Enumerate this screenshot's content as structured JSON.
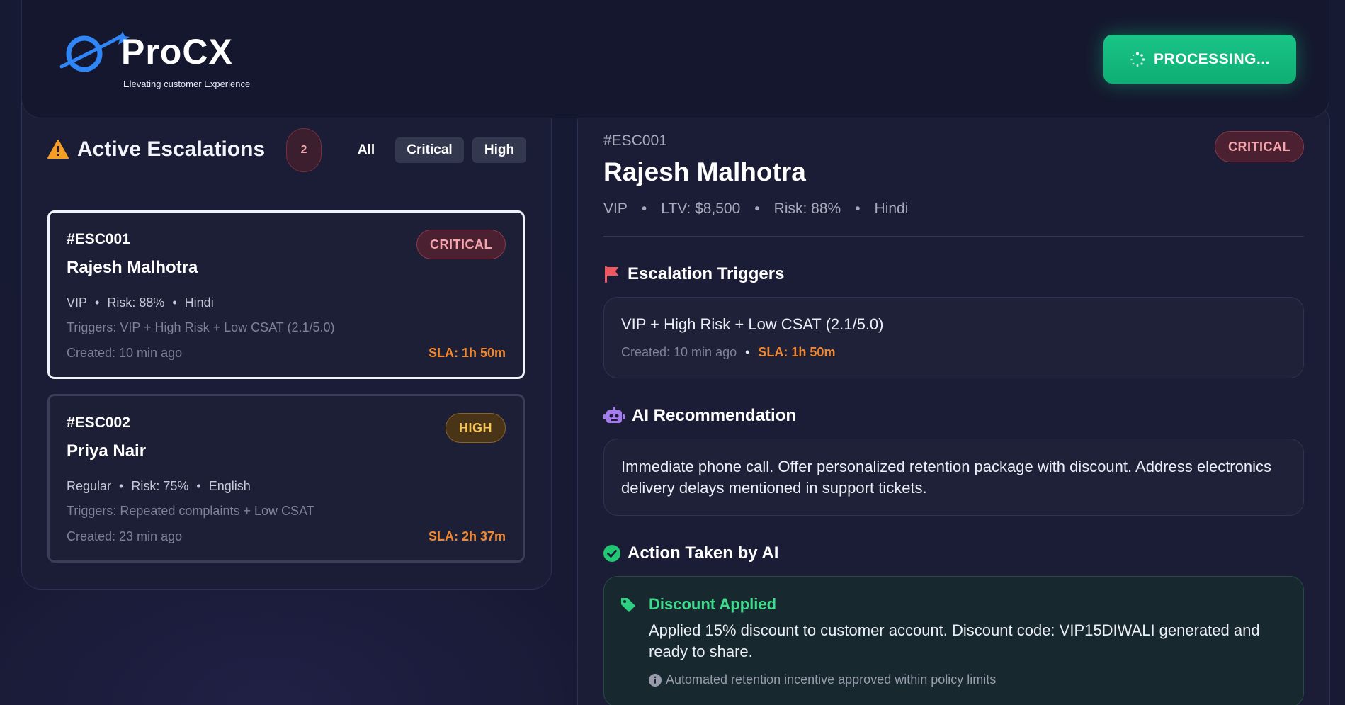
{
  "header": {
    "brand": "ProCX",
    "tagline": "Elevating customer Experience",
    "processing_label": "PROCESSING..."
  },
  "escalations": {
    "title": "Active Escalations",
    "count": "2",
    "filters": [
      "All",
      "Critical",
      "High"
    ],
    "cards": [
      {
        "id": "#ESC001",
        "name": "Rajesh Malhotra",
        "priority": "CRITICAL",
        "tier": "VIP",
        "risk": "Risk: 88%",
        "language": "Hindi",
        "triggers": "Triggers: VIP + High Risk + Low CSAT (2.1/5.0)",
        "created": "Created: 10 min ago",
        "sla": "SLA: 1h 50m"
      },
      {
        "id": "#ESC002",
        "name": "Priya Nair",
        "priority": "HIGH",
        "tier": "Regular",
        "risk": "Risk: 75%",
        "language": "English",
        "triggers": "Triggers: Repeated complaints + Low CSAT",
        "created": "Created: 23 min ago",
        "sla": "SLA: 2h 37m"
      }
    ]
  },
  "detail": {
    "id": "#ESC001",
    "priority": "CRITICAL",
    "name": "Rajesh Malhotra",
    "tier": "VIP",
    "ltv": "LTV: $8,500",
    "risk": "Risk: 88%",
    "language": "Hindi",
    "triggers_heading": "Escalation Triggers",
    "triggers_text": "VIP + High Risk + Low CSAT (2.1/5.0)",
    "triggers_created": "Created: 10 min ago",
    "triggers_sla": "SLA: 1h 50m",
    "ai_heading": "AI Recommendation",
    "ai_text": "Immediate phone call. Offer personalized retention package with discount. Address electronics delivery delays mentioned in support tickets.",
    "action_heading": "Action Taken by AI",
    "action_title": "Discount Applied",
    "action_text": "Applied 15% discount to customer account. Discount code: VIP15DIWALI generated and ready to share.",
    "action_note": "Automated retention incentive approved within policy limits"
  },
  "colors": {
    "accent_green": "#19c486",
    "critical": "#f4a4aa",
    "high": "#f7c756",
    "sla": "#f2882e",
    "logo_blue": "#2f86f6"
  }
}
